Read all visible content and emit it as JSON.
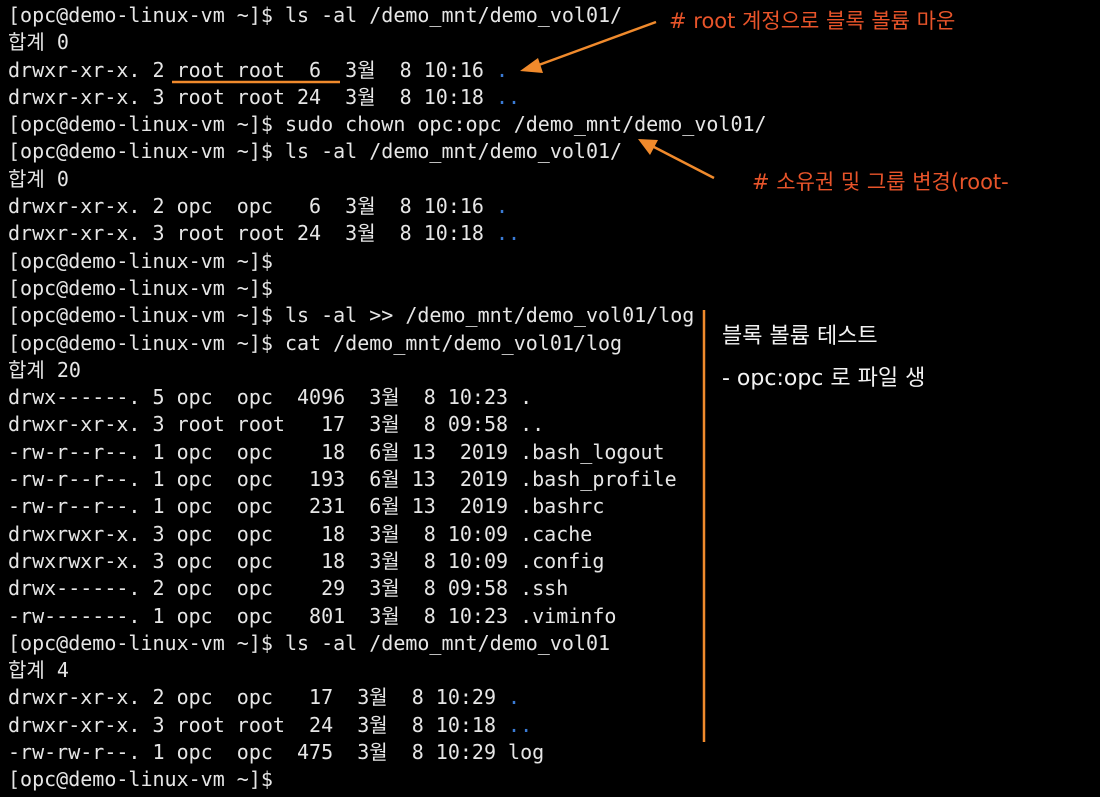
{
  "terminal": {
    "lines": [
      {
        "text": "[opc@demo-linux-vm ~]$ ls -al /demo_mnt/demo_vol01/"
      },
      {
        "text": "합계 0"
      },
      {
        "text": "drwxr-xr-x. 2 root root  6  3월  8 10:16 ",
        "hl": "."
      },
      {
        "text": "drwxr-xr-x. 3 root root 24  3월  8 10:18 ",
        "hl": ".."
      },
      {
        "text": "[opc@demo-linux-vm ~]$ sudo chown opc:opc /demo_mnt/demo_vol01/"
      },
      {
        "text": "[opc@demo-linux-vm ~]$ ls -al /demo_mnt/demo_vol01/"
      },
      {
        "text": "합계 0"
      },
      {
        "text": "drwxr-xr-x. 2 opc  opc   6  3월  8 10:16 ",
        "hl": "."
      },
      {
        "text": "drwxr-xr-x. 3 root root 24  3월  8 10:18 ",
        "hl": ".."
      },
      {
        "text": "[opc@demo-linux-vm ~]$"
      },
      {
        "text": "[opc@demo-linux-vm ~]$"
      },
      {
        "text": "[opc@demo-linux-vm ~]$ ls -al >> /demo_mnt/demo_vol01/log"
      },
      {
        "text": "[opc@demo-linux-vm ~]$ cat /demo_mnt/demo_vol01/log"
      },
      {
        "text": "합계 20"
      },
      {
        "text": "drwx------. 5 opc  opc  4096  3월  8 10:23 ."
      },
      {
        "text": "drwxr-xr-x. 3 root root   17  3월  8 09:58 .."
      },
      {
        "text": "-rw-r--r--. 1 opc  opc    18  6월 13  2019 .bash_logout"
      },
      {
        "text": "-rw-r--r--. 1 opc  opc   193  6월 13  2019 .bash_profile"
      },
      {
        "text": "-rw-r--r--. 1 opc  opc   231  6월 13  2019 .bashrc"
      },
      {
        "text": "drwxrwxr-x. 3 opc  opc    18  3월  8 10:09 .cache"
      },
      {
        "text": "drwxrwxr-x. 3 opc  opc    18  3월  8 10:09 .config"
      },
      {
        "text": "drwx------. 2 opc  opc    29  3월  8 09:58 .ssh"
      },
      {
        "text": "-rw-------. 1 opc  opc   801  3월  8 10:23 .viminfo"
      },
      {
        "text": "[opc@demo-linux-vm ~]$ ls -al /demo_mnt/demo_vol01"
      },
      {
        "text": "합계 4"
      },
      {
        "text": "drwxr-xr-x. 2 opc  opc   17  3월  8 10:29 ",
        "hl": "."
      },
      {
        "text": "drwxr-xr-x. 3 root root  24  3월  8 10:18 ",
        "hl": ".."
      },
      {
        "text": "-rw-rw-r--. 1 opc  opc  475  3월  8 10:29 log"
      },
      {
        "text": "[opc@demo-linux-vm ~]$"
      }
    ]
  },
  "annotations": {
    "mount_note": "# root 계정으로 블록 볼륨 마운",
    "chown_note": "# 소유권 및 그룹 변경(root-",
    "test_title": "블록 볼륨 테스트",
    "test_subtitle": "- opc:opc 로 파일 생"
  },
  "colors": {
    "background": "#000000",
    "text": "#e6e6e6",
    "directory": "#3a7bd5",
    "annotation": "#e8542a",
    "annotation_line": "#f08a2c",
    "white_note": "#f2f2f2"
  }
}
